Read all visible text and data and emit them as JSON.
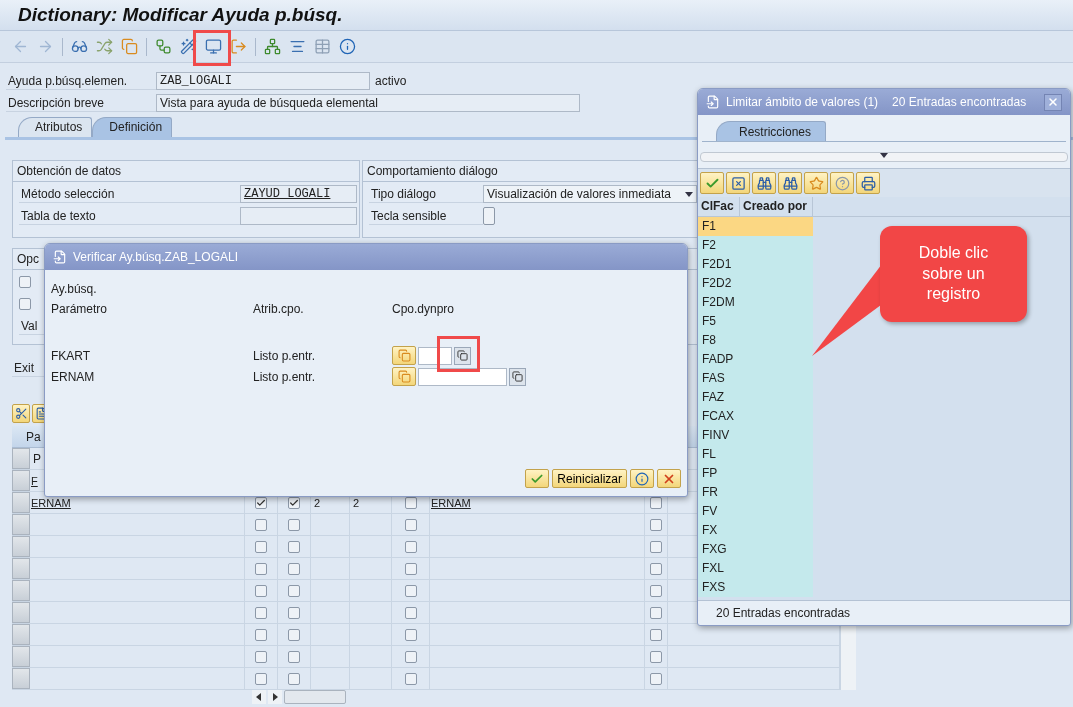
{
  "window": {
    "title": "Dictionary: Modificar Ayuda p.búsq."
  },
  "header_fields": [
    {
      "label": "Ayuda p.búsq.elemen.",
      "value": "ZAB_LOGALI",
      "status": "activo"
    },
    {
      "label": "Descripción breve",
      "value": "Vista para ayuda de búsqueda elemental"
    }
  ],
  "tabs": [
    {
      "label": "Atributos",
      "selected": false
    },
    {
      "label": "Definición",
      "selected": true
    }
  ],
  "data_group": {
    "title": "Obtención de datos",
    "fields": [
      {
        "label": "Método selección",
        "value": "ZAYUD_LOGALI"
      },
      {
        "label": "Tabla de texto"
      }
    ]
  },
  "dialog_group": {
    "title": "Comportamiento diálogo",
    "dialog_type": {
      "label": "Tipo diálogo",
      "value": "Visualización de valores inmediata"
    },
    "hotkey": {
      "label": "Tecla sensible",
      "checked": false
    }
  },
  "options_group": {
    "title": "Opc",
    "checkboxes": [
      {
        "checked": false
      },
      {
        "checked": false
      }
    ],
    "value_label": "Val"
  },
  "exit_label": "Exit",
  "param_table": {
    "group_header": "Pa",
    "column_header": "P",
    "rows": [
      {
        "parameter": "F"
      },
      {
        "parameter": "ERNAM",
        "import": true,
        "export": true,
        "lpos": "2",
        "spos": "2",
        "default": false,
        "data_element": "ERNAM",
        "modified": false
      },
      {
        "import": false,
        "export": false,
        "default": false,
        "modified": false
      },
      {
        "import": false,
        "export": false,
        "default": false,
        "modified": false
      },
      {
        "import": false,
        "export": false,
        "default": false,
        "modified": false
      },
      {
        "import": false,
        "export": false,
        "default": false,
        "modified": false
      },
      {
        "import": false,
        "export": false,
        "default": false,
        "modified": false
      },
      {
        "import": false,
        "export": false,
        "default": false,
        "modified": false
      },
      {
        "import": false,
        "export": false,
        "default": false,
        "modified": false
      },
      {
        "import": false,
        "export": false,
        "default": false,
        "modified": false
      }
    ]
  },
  "check_dialog": {
    "title": "Verificar Ay.búsq.ZAB_LOGALI",
    "label": "Ay.búsq.",
    "columns": [
      "Parámetro",
      "Atrib.cpo.",
      "Cpo.dynpro"
    ],
    "rows": [
      {
        "parameter": "FKART",
        "attribute": "Listo p.entr."
      },
      {
        "parameter": "ERNAM",
        "attribute": "Listo p.entr."
      }
    ],
    "buttons": [
      {
        "kind": "confirm"
      },
      {
        "kind": "text",
        "label": "Reinicializar"
      },
      {
        "kind": "info"
      },
      {
        "kind": "cancel"
      }
    ]
  },
  "value_popup": {
    "title": "Limitar ámbito de valores (1)",
    "count": "20 Entradas encontradas",
    "tab": {
      "label": "Restricciones",
      "selected": true
    },
    "columns": [
      "ClFac",
      "Creado por"
    ],
    "rows": [
      {
        "value": "F1",
        "selected": true
      },
      {
        "value": "F2",
        "selected": false
      },
      {
        "value": "F2D1",
        "selected": false
      },
      {
        "value": "F2D2",
        "selected": false
      },
      {
        "value": "F2DM",
        "selected": false
      },
      {
        "value": "F5",
        "selected": false
      },
      {
        "value": "F8",
        "selected": false
      },
      {
        "value": "FADP",
        "selected": false
      },
      {
        "value": "FAS",
        "selected": false
      },
      {
        "value": "FAZ",
        "selected": false
      },
      {
        "value": "FCAX",
        "selected": false
      },
      {
        "value": "FINV",
        "selected": false
      },
      {
        "value": "FL",
        "selected": false
      },
      {
        "value": "FP",
        "selected": false
      },
      {
        "value": "FR",
        "selected": false
      },
      {
        "value": "FV",
        "selected": false
      },
      {
        "value": "FX",
        "selected": false
      },
      {
        "value": "FXG",
        "selected": false
      },
      {
        "value": "FXL",
        "selected": false
      },
      {
        "value": "FXS",
        "selected": false
      }
    ],
    "status": "20 Entradas encontradas"
  },
  "callout": {
    "text": "Doble clic sobre un registro"
  }
}
